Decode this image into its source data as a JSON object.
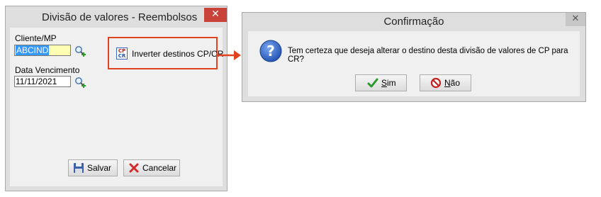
{
  "window1": {
    "title": "Divisão de valores - Reembolsos",
    "close_symbol": "✕",
    "cliente_label": "Cliente/MP",
    "cliente_value": "ABCIND",
    "data_label": "Data Vencimento",
    "data_value": "11/11/2021",
    "invert_icon_top": "CP",
    "invert_icon_bottom": "CR",
    "invert_label": "Inverter destinos CP/CR",
    "save_label": "Salvar",
    "cancel_label": "Cancelar",
    "icons": [
      "search-plus-icon",
      "save-disk-icon",
      "cancel-x-icon",
      "cp-cr-icon"
    ]
  },
  "window2": {
    "title": "Confirmação",
    "close_symbol": "✕",
    "message": "Tem certeza que deseja alterar o destino desta divisão de valores de CP para CR?",
    "yes_label_first": "S",
    "yes_label_rest": "im",
    "no_label_first": "N",
    "no_label_rest": "ão",
    "icons": [
      "question-icon",
      "checkmark-icon",
      "prohibited-icon"
    ]
  },
  "colors": {
    "highlight_box": "#e0431f",
    "close_button_active": "#c8423a",
    "selection": "#3399ff",
    "field_yellow": "#ffffb4"
  }
}
